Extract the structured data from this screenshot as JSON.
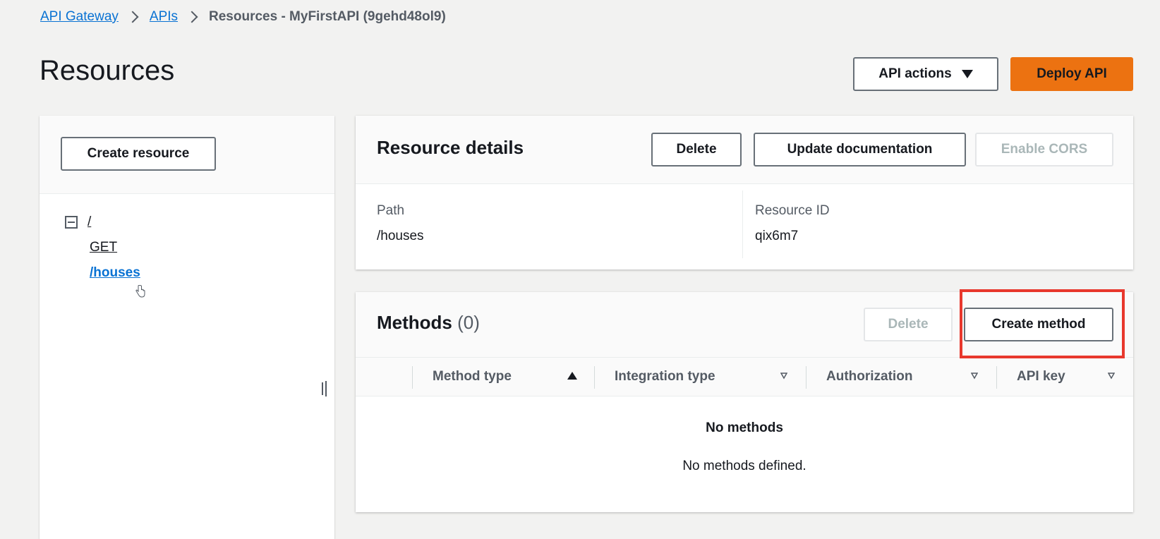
{
  "breadcrumb": {
    "items": [
      "API Gateway",
      "APIs"
    ],
    "current": "Resources - MyFirstAPI (9gehd48ol9)"
  },
  "page": {
    "title": "Resources",
    "api_actions_label": "API actions",
    "deploy_label": "Deploy API"
  },
  "left_panel": {
    "create_resource_label": "Create resource",
    "tree": {
      "root": "/",
      "children": [
        "GET",
        "/houses"
      ]
    }
  },
  "resource_details": {
    "title": "Resource details",
    "delete_label": "Delete",
    "update_docs_label": "Update documentation",
    "enable_cors_label": "Enable CORS",
    "path_label": "Path",
    "path_value": "/houses",
    "resource_id_label": "Resource ID",
    "resource_id_value": "qix6m7"
  },
  "methods": {
    "title": "Methods",
    "count": "(0)",
    "delete_label": "Delete",
    "create_label": "Create method",
    "columns": [
      "Method type",
      "Integration type",
      "Authorization",
      "API key"
    ],
    "empty_title": "No methods",
    "empty_desc": "No methods defined."
  },
  "colors": {
    "accent": "#ec7211",
    "link": "#0972d3",
    "highlight": "#e8382d"
  }
}
